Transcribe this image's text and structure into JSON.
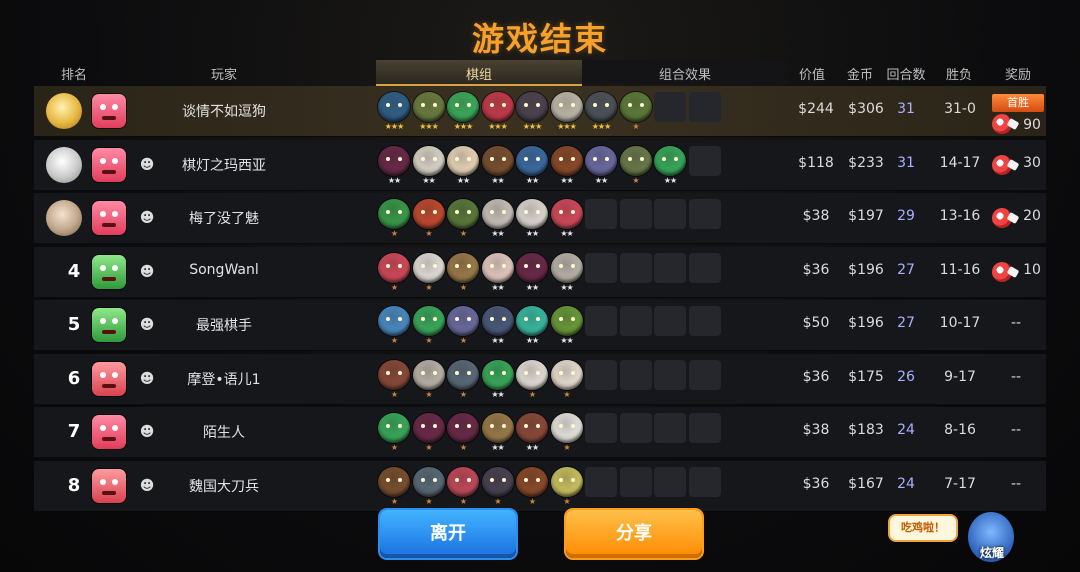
{
  "title": "游戏结束",
  "headers": {
    "rank": "排名",
    "player": "玩家",
    "lineup_tab": "棋组",
    "combo_tab": "组合效果",
    "value": "价值",
    "gold": "金币",
    "rounds": "回合数",
    "record": "胜负",
    "reward": "奖励"
  },
  "rows": [
    {
      "rank": "",
      "medal": "gold",
      "avatar": "av-red",
      "name": "谈情不如逗狗",
      "value": "$244",
      "gold": "$306",
      "rounds": "31",
      "record": "31-0",
      "reward": "90",
      "first_win": "首胜",
      "pieces": [
        [
          "#2f5e88",
          "3",
          "s-gold"
        ],
        [
          "#6a7a40",
          "3",
          "s-gold"
        ],
        [
          "#3aa85a",
          "3",
          "s-gold"
        ],
        [
          "#c03a4a",
          "3",
          "s-gold"
        ],
        [
          "#4a4250",
          "3",
          "s-gold"
        ],
        [
          "#bcb6aa",
          "3",
          "s-gold"
        ],
        [
          "#4b5258",
          "3",
          "s-gold"
        ],
        [
          "#5c7a3a",
          "1",
          "s-bronze"
        ]
      ]
    },
    {
      "rank": "",
      "medal": "silver",
      "avatar": "av-red",
      "name": "棋灯之玛西亚",
      "value": "$118",
      "gold": "$233",
      "rounds": "31",
      "record": "14-17",
      "reward": "30",
      "first_win": "",
      "pieces": [
        [
          "#6a2a48",
          "2",
          "s-silver"
        ],
        [
          "#d8d2c6",
          "2",
          "s-silver"
        ],
        [
          "#e6d2b6",
          "2",
          "s-silver"
        ],
        [
          "#7a5030",
          "2",
          "s-silver"
        ],
        [
          "#3c6aa0",
          "2",
          "s-silver"
        ],
        [
          "#8a4a2a",
          "2",
          "s-silver"
        ],
        [
          "#6a6aa0",
          "2",
          "s-silver"
        ],
        [
          "#6a7a4a",
          "1",
          "s-bronze"
        ],
        [
          "#3aa85a",
          "2",
          "s-silver"
        ]
      ]
    },
    {
      "rank": "",
      "medal": "bronze",
      "avatar": "av-red",
      "name": "梅了没了魅",
      "value": "$38",
      "gold": "$197",
      "rounds": "29",
      "record": "13-16",
      "reward": "20",
      "first_win": "",
      "pieces": [
        [
          "#3a9a4a",
          "1",
          "s-bronze"
        ],
        [
          "#c04a30",
          "1",
          "s-bronze"
        ],
        [
          "#5a7a3a",
          "1",
          "s-bronze"
        ],
        [
          "#c8c0b8",
          "2",
          "s-silver"
        ],
        [
          "#dcd6d0",
          "2",
          "s-silver"
        ],
        [
          "#d04a5a",
          "2",
          "s-silver"
        ]
      ]
    },
    {
      "rank": "4",
      "medal": "",
      "avatar": "av-green",
      "name": "SongWanl",
      "value": "$36",
      "gold": "$196",
      "rounds": "27",
      "record": "11-16",
      "reward": "10",
      "first_win": "",
      "pieces": [
        [
          "#d04a5a",
          "1",
          "s-bronze"
        ],
        [
          "#e2dcd6",
          "1",
          "s-bronze"
        ],
        [
          "#9a7a4a",
          "1",
          "s-bronze"
        ],
        [
          "#e2c8c0",
          "2",
          "s-silver"
        ],
        [
          "#6a2a48",
          "2",
          "s-silver"
        ],
        [
          "#b8b2a8",
          "2",
          "s-silver"
        ]
      ]
    },
    {
      "rank": "5",
      "medal": "",
      "avatar": "av-green",
      "name": "最强棋手",
      "value": "$50",
      "gold": "$196",
      "rounds": "27",
      "record": "10-17",
      "reward": "--",
      "first_win": "",
      "pieces": [
        [
          "#4a8ac0",
          "1",
          "s-bronze"
        ],
        [
          "#3aa85a",
          "1",
          "s-bronze"
        ],
        [
          "#6a6aa0",
          "1",
          "s-bronze"
        ],
        [
          "#4a5a7a",
          "2",
          "s-silver"
        ],
        [
          "#3ab8a0",
          "2",
          "s-silver"
        ],
        [
          "#6a9a3a",
          "2",
          "s-silver"
        ]
      ]
    },
    {
      "rank": "6",
      "medal": "",
      "avatar": "av-pink",
      "name": "摩登•语儿1",
      "value": "$36",
      "gold": "$175",
      "rounds": "26",
      "record": "9-17",
      "reward": "--",
      "first_win": "",
      "pieces": [
        [
          "#8a4a3a",
          "1",
          "s-bronze"
        ],
        [
          "#b8b2a8",
          "1",
          "s-bronze"
        ],
        [
          "#5a6a78",
          "1",
          "s-bronze"
        ],
        [
          "#3aa85a",
          "2",
          "s-silver"
        ],
        [
          "#e2dcd6",
          "1",
          "s-bronze"
        ],
        [
          "#e6dcd0",
          "1",
          "s-bronze"
        ]
      ]
    },
    {
      "rank": "7",
      "medal": "",
      "avatar": "av-red",
      "name": "陌生人",
      "value": "$38",
      "gold": "$183",
      "rounds": "24",
      "record": "8-16",
      "reward": "--",
      "first_win": "",
      "pieces": [
        [
          "#3aa85a",
          "1",
          "s-bronze"
        ],
        [
          "#6a2a48",
          "1",
          "s-bronze"
        ],
        [
          "#6a2a48",
          "1",
          "s-bronze"
        ],
        [
          "#9a7a4a",
          "2",
          "s-silver"
        ],
        [
          "#8a4a3a",
          "2",
          "s-silver"
        ],
        [
          "#e6e2dc",
          "1",
          "s-bronze"
        ]
      ]
    },
    {
      "rank": "8",
      "medal": "",
      "avatar": "av-pink",
      "name": "魏国大刀兵",
      "value": "$36",
      "gold": "$167",
      "rounds": "24",
      "record": "7-17",
      "reward": "--",
      "first_win": "",
      "pieces": [
        [
          "#7a5030",
          "1",
          "s-bronze"
        ],
        [
          "#5a6a78",
          "1",
          "s-bronze"
        ],
        [
          "#c04a5a",
          "1",
          "s-bronze"
        ],
        [
          "#4a4250",
          "1",
          "s-bronze"
        ],
        [
          "#8a4a2a",
          "1",
          "s-bronze"
        ],
        [
          "#c8c060",
          "1",
          "s-bronze"
        ]
      ]
    }
  ],
  "buttons": {
    "leave": "离开",
    "share": "分享"
  },
  "bubble": "吃鸡啦！",
  "mascot_label": "炫耀",
  "colors": {
    "accent": "#f7a12a",
    "round": "#a9b0ff"
  }
}
